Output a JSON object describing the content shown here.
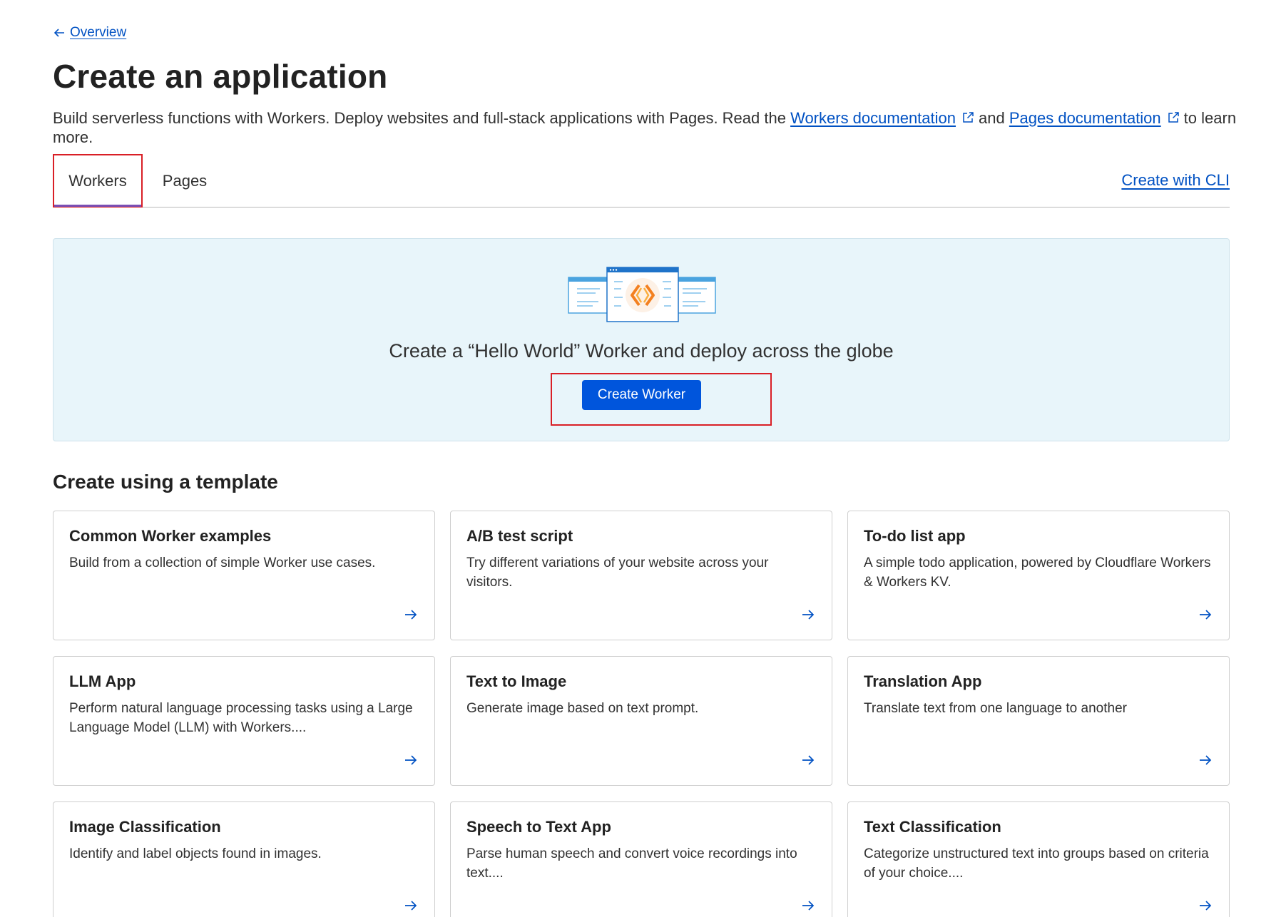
{
  "nav": {
    "back_label": "Overview"
  },
  "header": {
    "title": "Create an application",
    "intro_before": "Build serverless functions with Workers. Deploy websites and full-stack applications with Pages. Read the ",
    "workers_docs_link": "Workers documentation",
    "intro_and": "and ",
    "pages_docs_link": "Pages documentation",
    "intro_after": "to learn more."
  },
  "tabs": [
    {
      "label": "Workers",
      "active": true
    },
    {
      "label": "Pages",
      "active": false
    }
  ],
  "cli_link": "Create with CLI",
  "hero": {
    "text": "Create a “Hello World” Worker and deploy across the globe",
    "button_label": "Create Worker"
  },
  "templates": {
    "title": "Create using a template",
    "cards": [
      {
        "title": "Common Worker examples",
        "desc": "Build from a collection of simple Worker use cases."
      },
      {
        "title": "A/B test script",
        "desc": "Try different variations of your website across your visitors."
      },
      {
        "title": "To-do list app",
        "desc": "A simple todo application, powered by Cloudflare Workers & Workers KV."
      },
      {
        "title": "LLM App",
        "desc": "Perform natural language processing tasks using a Large Language Model (LLM) with Workers...."
      },
      {
        "title": "Text to Image",
        "desc": "Generate image based on text prompt."
      },
      {
        "title": "Translation App",
        "desc": "Translate text from one language to another"
      },
      {
        "title": "Image Classification",
        "desc": "Identify and label objects found in images."
      },
      {
        "title": "Speech to Text App",
        "desc": "Parse human speech and convert voice recordings into text...."
      },
      {
        "title": "Text Classification",
        "desc": "Categorize unstructured text into groups based on criteria of your choice...."
      }
    ]
  },
  "colors": {
    "link": "#0051c3",
    "primary_button": "#0055dc",
    "hero_bg": "#e8f5fa",
    "highlight_border": "#d91f26",
    "illustration_accent": "#f38020"
  }
}
